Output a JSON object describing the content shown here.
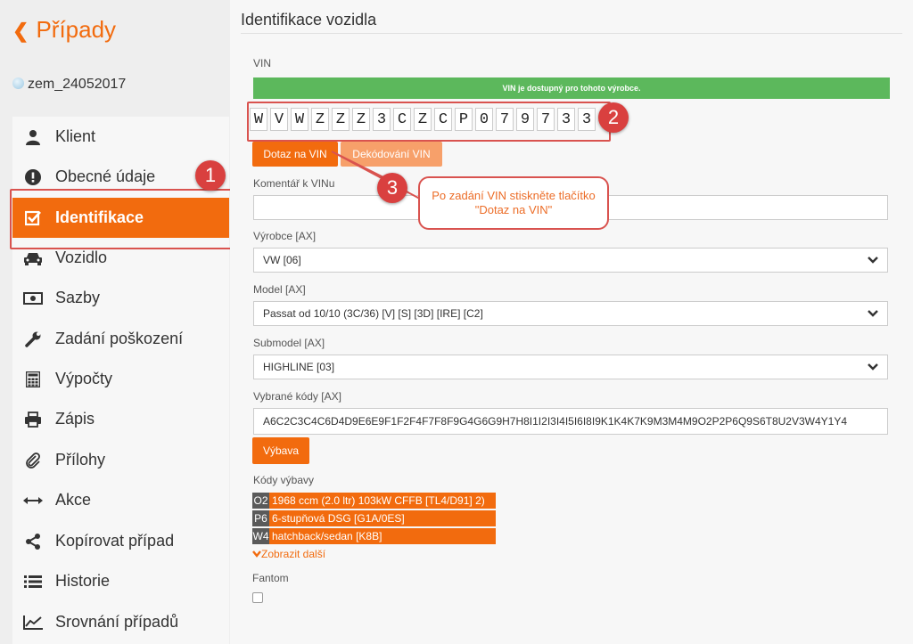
{
  "sidebar": {
    "back_label": "Případy",
    "case_id": "zem_24052017",
    "items": [
      {
        "label": "Klient",
        "icon": "user-icon"
      },
      {
        "label": "Obecné údaje",
        "icon": "exclamation-icon"
      },
      {
        "label": "Identifikace",
        "icon": "checkbox-icon",
        "active": true
      },
      {
        "label": "Vozidlo",
        "icon": "car-icon"
      },
      {
        "label": "Sazby",
        "icon": "money-icon"
      },
      {
        "label": "Zadání poškození",
        "icon": "wrench-icon"
      },
      {
        "label": "Výpočty",
        "icon": "calculator-icon"
      },
      {
        "label": "Zápis",
        "icon": "print-icon"
      },
      {
        "label": "Přílohy",
        "icon": "paperclip-icon"
      },
      {
        "label": "Akce",
        "icon": "arrows-icon"
      },
      {
        "label": "Kopírovat případ",
        "icon": "share-icon"
      },
      {
        "label": "Historie",
        "icon": "list-icon"
      },
      {
        "label": "Srovnání případů",
        "icon": "chart-icon"
      }
    ]
  },
  "main": {
    "title": "Identifikace vozidla",
    "vin_label": "VIN",
    "vin_available": "VIN je dostupný pro tohoto výrobce.",
    "vin_chars": [
      "W",
      "V",
      "W",
      "Z",
      "Z",
      "Z",
      "3",
      "C",
      "Z",
      "C",
      "P",
      "0",
      "7",
      "9",
      "7",
      "3",
      "3"
    ],
    "btn_query": "Dotaz na VIN",
    "btn_decode": "Dekódování VIN",
    "comment_label": "Komentář k VINu",
    "comment_value": "",
    "manufacturer_label": "Výrobce [AX]",
    "manufacturer_value": "VW [06]",
    "model_label": "Model [AX]",
    "model_value": "Passat od 10/10 (3C/36) [V] [S] [3D] [IRE] [C2]",
    "submodel_label": "Submodel [AX]",
    "submodel_value": "HIGHLINE [03]",
    "codes_label": "Vybrané kódy [AX]",
    "codes_value": "A6C2C3C4C6D4D9E6E9F1F2F4F7F8F9G4G6G9H7H8I1I2I3I4I5I6I8I9K1K4K7K9M3M4M9O2P2P6Q9S6T8U2V3W4Y1Y4",
    "btn_equipment": "Výbava",
    "equipment_label": "Kódy výbavy",
    "equipment": [
      {
        "code": "O2",
        "text": "1968 ccm (2.0 ltr) 103kW CFFB [TL4/D91] 2)"
      },
      {
        "code": "P6",
        "text": "6-stupňová DSG [G1A/0ES]"
      },
      {
        "code": "W4",
        "text": "hatchback/sedan [K8B]"
      }
    ],
    "show_more": "Zobrazit další",
    "fantom_label": "Fantom"
  },
  "annotations": {
    "badge1": "1",
    "badge2": "2",
    "badge3": "3",
    "tooltip": "Po zadání VIN stiskněte tlačítko \"Dotaz na VIN\""
  },
  "colors": {
    "accent": "#f26b0e",
    "success": "#5cb85c",
    "annotation": "#d9403f"
  }
}
